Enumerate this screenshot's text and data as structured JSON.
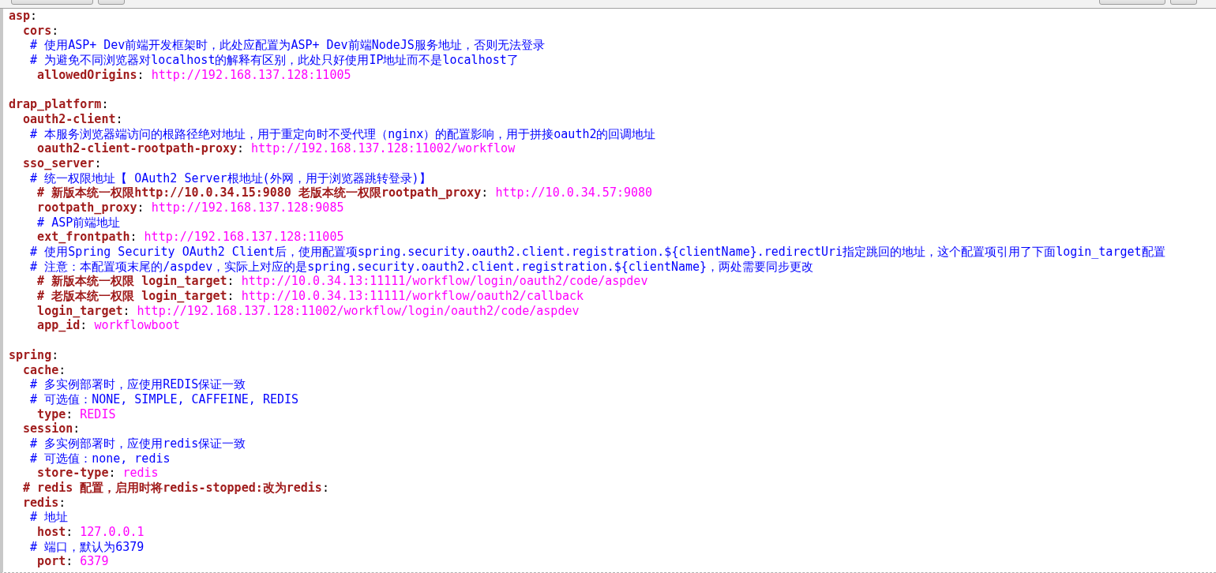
{
  "editor": {
    "lines": [
      {
        "kind": "code",
        "segments": [
          {
            "kind": "key",
            "text": "asp"
          },
          {
            "kind": "punct",
            "text": ":"
          }
        ]
      },
      {
        "kind": "code",
        "segments": [
          {
            "kind": "key",
            "text": "  cors"
          },
          {
            "kind": "punct",
            "text": ":"
          }
        ]
      },
      {
        "kind": "code",
        "segments": [
          {
            "kind": "comment",
            "text": "   # 使用ASP+ Dev前端开发框架时，此处应配置为ASP+ Dev前端NodeJS服务地址，否则无法登录"
          }
        ]
      },
      {
        "kind": "code",
        "segments": [
          {
            "kind": "comment",
            "text": "   # 为避免不同浏览器对localhost的解释有区别，此处只好使用IP地址而不是localhost了"
          }
        ]
      },
      {
        "kind": "code",
        "segments": [
          {
            "kind": "key",
            "text": "    allowedOrigins"
          },
          {
            "kind": "punct",
            "text": ": "
          },
          {
            "kind": "value",
            "text": "http://192.168.137.128:11005"
          }
        ]
      },
      {
        "kind": "blank"
      },
      {
        "kind": "code",
        "segments": [
          {
            "kind": "key",
            "text": "drap_platform"
          },
          {
            "kind": "punct",
            "text": ":"
          }
        ]
      },
      {
        "kind": "code",
        "segments": [
          {
            "kind": "key",
            "text": "  oauth2-client"
          },
          {
            "kind": "punct",
            "text": ":"
          }
        ]
      },
      {
        "kind": "code",
        "segments": [
          {
            "kind": "comment",
            "text": "   # 本服务浏览器端访问的根路径绝对地址，用于重定向时不受代理（nginx）的配置影响，用于拼接oauth2的回调地址"
          }
        ]
      },
      {
        "kind": "code",
        "segments": [
          {
            "kind": "key",
            "text": "    oauth2-client-rootpath-proxy"
          },
          {
            "kind": "punct",
            "text": ": "
          },
          {
            "kind": "value",
            "text": "http://192.168.137.128:11002/workflow"
          }
        ]
      },
      {
        "kind": "code",
        "segments": [
          {
            "kind": "key",
            "text": "  sso_server"
          },
          {
            "kind": "punct",
            "text": ":"
          }
        ]
      },
      {
        "kind": "code",
        "segments": [
          {
            "kind": "comment",
            "text": "   # 统一权限地址【 OAuth2 Server根地址(外网，用于浏览器跳转登录)】"
          }
        ]
      },
      {
        "kind": "code",
        "segments": [
          {
            "kind": "heading",
            "text": "    # 新版本统一权限http://10.0.34.15:9080 老版本统一权限rootpath_proxy"
          },
          {
            "kind": "punct",
            "text": ": "
          },
          {
            "kind": "value",
            "text": "http://10.0.34.57:9080"
          }
        ]
      },
      {
        "kind": "code",
        "segments": [
          {
            "kind": "key",
            "text": "    rootpath_proxy"
          },
          {
            "kind": "punct",
            "text": ": "
          },
          {
            "kind": "value",
            "text": "http://192.168.137.128:9085"
          }
        ]
      },
      {
        "kind": "code",
        "segments": [
          {
            "kind": "comment",
            "text": "    # ASP前端地址"
          }
        ]
      },
      {
        "kind": "code",
        "segments": [
          {
            "kind": "key",
            "text": "    ext_frontpath"
          },
          {
            "kind": "punct",
            "text": ": "
          },
          {
            "kind": "value",
            "text": "http://192.168.137.128:11005"
          }
        ]
      },
      {
        "kind": "code",
        "segments": [
          {
            "kind": "comment",
            "text": "   # 使用Spring Security OAuth2 Client后，使用配置项spring.security.oauth2.client.registration.${clientName}.redirectUri指定跳回的地址，这个配置项引用了下面login_target配置"
          }
        ]
      },
      {
        "kind": "code",
        "segments": [
          {
            "kind": "comment",
            "text": "   # 注意：本配置项末尾的/aspdev，实际上对应的是spring.security.oauth2.client.registration.${clientName}，两处需要同步更改"
          }
        ]
      },
      {
        "kind": "code",
        "segments": [
          {
            "kind": "heading",
            "text": "    # 新版本统一权限 login_target"
          },
          {
            "kind": "punct",
            "text": ": "
          },
          {
            "kind": "value",
            "text": "http://10.0.34.13:11111/workflow/login/oauth2/code/aspdev"
          }
        ]
      },
      {
        "kind": "code",
        "segments": [
          {
            "kind": "heading",
            "text": "    # 老版本统一权限 login_target"
          },
          {
            "kind": "punct",
            "text": ": "
          },
          {
            "kind": "value",
            "text": "http://10.0.34.13:11111/workflow/oauth2/callback"
          }
        ]
      },
      {
        "kind": "code",
        "segments": [
          {
            "kind": "key",
            "text": "    login_target"
          },
          {
            "kind": "punct",
            "text": ": "
          },
          {
            "kind": "value",
            "text": "http://192.168.137.128:11002/workflow/login/oauth2/code/aspdev"
          }
        ]
      },
      {
        "kind": "code",
        "segments": [
          {
            "kind": "key",
            "text": "    app_id"
          },
          {
            "kind": "punct",
            "text": ": "
          },
          {
            "kind": "value",
            "text": "workflowboot"
          }
        ]
      },
      {
        "kind": "blank"
      },
      {
        "kind": "code",
        "segments": [
          {
            "kind": "key",
            "text": "spring"
          },
          {
            "kind": "punct",
            "text": ":"
          }
        ]
      },
      {
        "kind": "code",
        "segments": [
          {
            "kind": "key",
            "text": "  cache"
          },
          {
            "kind": "punct",
            "text": ":"
          }
        ]
      },
      {
        "kind": "code",
        "segments": [
          {
            "kind": "comment",
            "text": "   # 多实例部署时，应使用REDIS保证一致"
          }
        ]
      },
      {
        "kind": "code",
        "segments": [
          {
            "kind": "comment",
            "text": "   # 可选值：NONE, SIMPLE, CAFFEINE, REDIS"
          }
        ]
      },
      {
        "kind": "code",
        "segments": [
          {
            "kind": "key",
            "text": "    type"
          },
          {
            "kind": "punct",
            "text": ": "
          },
          {
            "kind": "value",
            "text": "REDIS"
          }
        ]
      },
      {
        "kind": "code",
        "segments": [
          {
            "kind": "key",
            "text": "  session"
          },
          {
            "kind": "punct",
            "text": ":"
          }
        ]
      },
      {
        "kind": "code",
        "segments": [
          {
            "kind": "comment",
            "text": "   # 多实例部署时，应使用redis保证一致"
          }
        ]
      },
      {
        "kind": "code",
        "segments": [
          {
            "kind": "comment",
            "text": "   # 可选值：none, redis"
          }
        ]
      },
      {
        "kind": "code",
        "segments": [
          {
            "kind": "key",
            "text": "    store-type"
          },
          {
            "kind": "punct",
            "text": ": "
          },
          {
            "kind": "value",
            "text": "redis"
          }
        ]
      },
      {
        "kind": "code",
        "segments": [
          {
            "kind": "heading",
            "text": "  # redis 配置，启用时将redis-stopped:改为redis"
          },
          {
            "kind": "punct",
            "text": ":"
          }
        ]
      },
      {
        "kind": "code",
        "segments": [
          {
            "kind": "key",
            "text": "  redis"
          },
          {
            "kind": "punct",
            "text": ":"
          }
        ]
      },
      {
        "kind": "code",
        "segments": [
          {
            "kind": "comment",
            "text": "   # 地址"
          }
        ]
      },
      {
        "kind": "code",
        "segments": [
          {
            "kind": "key",
            "text": "    host"
          },
          {
            "kind": "punct",
            "text": ": "
          },
          {
            "kind": "value",
            "text": "127.0.0.1"
          }
        ]
      },
      {
        "kind": "code",
        "segments": [
          {
            "kind": "comment",
            "text": "   # 端口，默认为6379"
          }
        ]
      },
      {
        "kind": "code",
        "segments": [
          {
            "kind": "key",
            "text": "    port"
          },
          {
            "kind": "punct",
            "text": ": "
          },
          {
            "kind": "value",
            "text": "6379"
          }
        ]
      }
    ]
  }
}
